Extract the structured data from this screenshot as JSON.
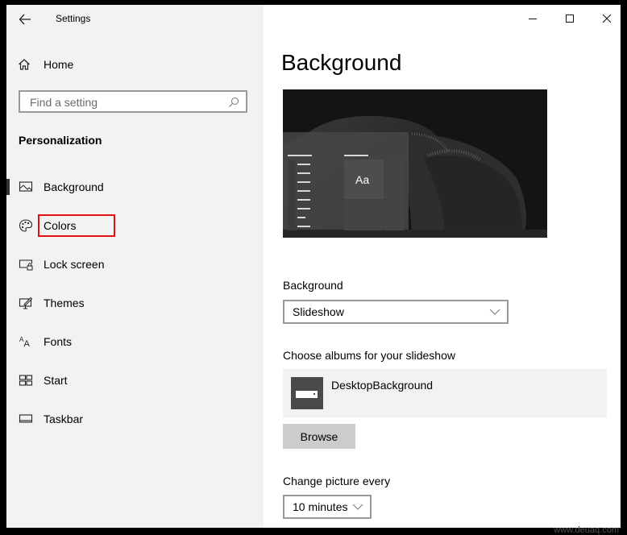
{
  "window": {
    "app_title": "Settings",
    "controls": {
      "minimize": "minimize-icon",
      "maximize": "maximize-icon",
      "close": "close-icon"
    }
  },
  "sidebar": {
    "back_icon": "arrow-left-icon",
    "home_label": "Home",
    "search_placeholder": "Find a setting",
    "section_title": "Personalization",
    "items": [
      {
        "label": "Background",
        "icon": "picture-icon",
        "active": true
      },
      {
        "label": "Colors",
        "icon": "palette-icon",
        "active": false,
        "highlighted": true
      },
      {
        "label": "Lock screen",
        "icon": "lock-screen-icon",
        "active": false
      },
      {
        "label": "Themes",
        "icon": "themes-icon",
        "active": false
      },
      {
        "label": "Fonts",
        "icon": "fonts-icon",
        "active": false
      },
      {
        "label": "Start",
        "icon": "start-icon",
        "active": false
      },
      {
        "label": "Taskbar",
        "icon": "taskbar-icon",
        "active": false
      }
    ]
  },
  "main": {
    "title": "Background",
    "preview": {
      "tile_text": "Aa"
    },
    "background_label": "Background",
    "background_value": "Slideshow",
    "albums_label": "Choose albums for your slideshow",
    "album_name": "DesktopBackground",
    "browse_label": "Browse",
    "change_label": "Change picture every",
    "change_value": "10 minutes"
  },
  "colors": {
    "highlight": "#e01010",
    "sidebar_bg": "#f2f2f2",
    "button_bg": "#cccccc"
  },
  "watermark": "www.deuaq.com"
}
